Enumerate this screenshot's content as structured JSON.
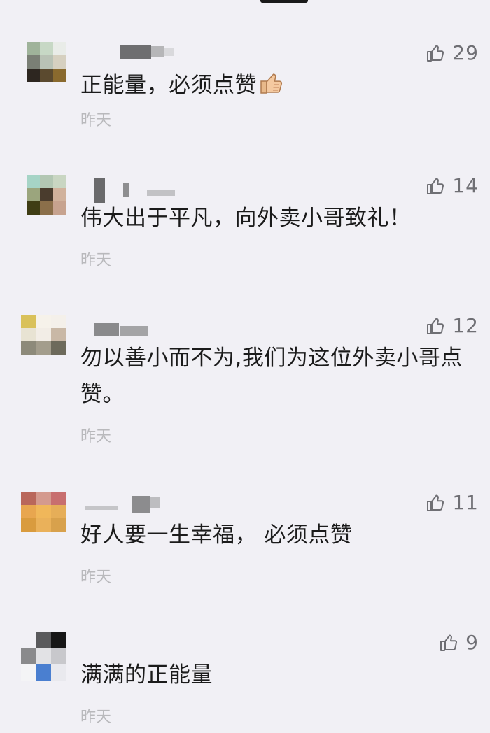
{
  "comments": [
    {
      "text": "正能量，必须点赞",
      "emoji": "thumbs-up-emoji",
      "time": "昨天",
      "likes": "29"
    },
    {
      "text": "伟大出于平凡，向外卖小哥致礼！",
      "time": "昨天",
      "likes": "14"
    },
    {
      "text": "勿以善小而不为,我们为这位外卖小哥点赞。",
      "time": "昨天",
      "likes": "12"
    },
    {
      "text": "好人要一生幸福， 必须点赞",
      "time": "昨天",
      "likes": "11"
    },
    {
      "text": "满满的正能量",
      "time": "昨天",
      "likes": "9"
    }
  ],
  "icons": {
    "like": "thumbs-up-outline-icon"
  },
  "colors": {
    "background": "#f1f0f5",
    "text": "#1b1b1b",
    "meta": "#b9b9bc",
    "like": "#6f6f74"
  }
}
